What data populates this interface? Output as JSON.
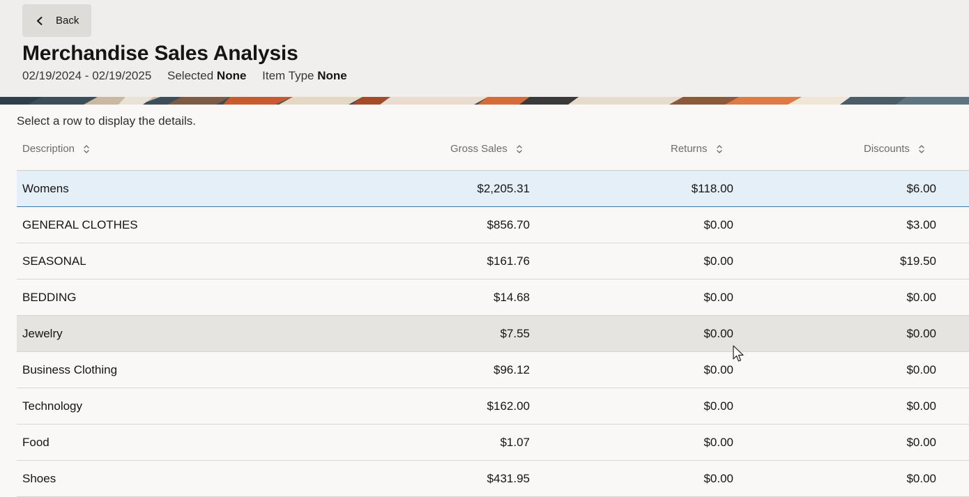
{
  "header": {
    "back_label": "Back",
    "title": "Merchandise Sales Analysis",
    "date_range": "02/19/2024 - 02/19/2025",
    "selected_label": "Selected",
    "selected_value": "None",
    "item_type_label": "Item Type",
    "item_type_value": "None"
  },
  "hint": "Select a row to display the details.",
  "table": {
    "columns": [
      {
        "label": "Description"
      },
      {
        "label": "Gross Sales"
      },
      {
        "label": "Returns"
      },
      {
        "label": "Discounts"
      }
    ],
    "rows": [
      {
        "description": "Womens",
        "gross_sales": "$2,205.31",
        "returns": "$118.00",
        "discounts": "$6.00"
      },
      {
        "description": "GENERAL CLOTHES",
        "gross_sales": "$856.70",
        "returns": "$0.00",
        "discounts": "$3.00"
      },
      {
        "description": "SEASONAL",
        "gross_sales": "$161.76",
        "returns": "$0.00",
        "discounts": "$19.50"
      },
      {
        "description": "BEDDING",
        "gross_sales": "$14.68",
        "returns": "$0.00",
        "discounts": "$0.00"
      },
      {
        "description": "Jewelry",
        "gross_sales": "$7.55",
        "returns": "$0.00",
        "discounts": "$0.00"
      },
      {
        "description": "Business Clothing",
        "gross_sales": "$96.12",
        "returns": "$0.00",
        "discounts": "$0.00"
      },
      {
        "description": "Technology",
        "gross_sales": "$162.00",
        "returns": "$0.00",
        "discounts": "$0.00"
      },
      {
        "description": "Food",
        "gross_sales": "$1.07",
        "returns": "$0.00",
        "discounts": "$0.00"
      },
      {
        "description": "Shoes",
        "gross_sales": "$431.95",
        "returns": "$0.00",
        "discounts": "$0.00"
      }
    ]
  },
  "icons": {
    "back": "chevron-left-icon",
    "sort": "sort-icon",
    "cursor": "mouse-pointer-icon"
  },
  "colors": {
    "selected_row": "#e4eff8",
    "selected_border": "#3b73a3",
    "hover_row": "#e6e4e1"
  }
}
